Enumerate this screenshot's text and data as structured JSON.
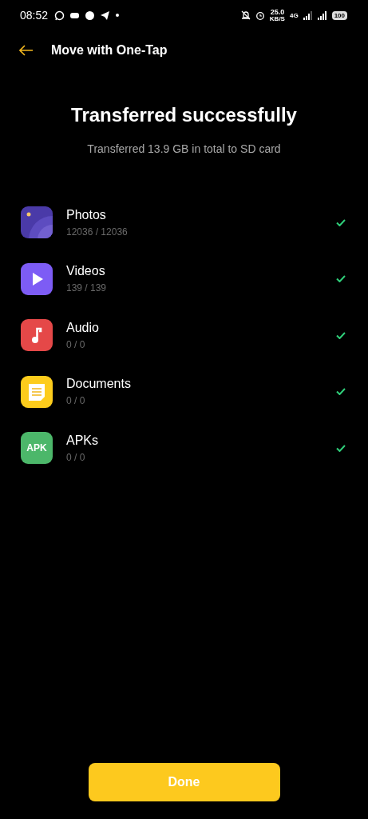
{
  "status_bar": {
    "time": "08:52",
    "speed": "25.0",
    "speed_unit": "KB/S",
    "network": "4G",
    "battery": "100"
  },
  "header": {
    "title": "Move with One-Tap"
  },
  "heading": "Transferred successfully",
  "summary": "Transferred 13.9 GB in total to SD card",
  "categories": [
    {
      "kind": "photos",
      "name": "Photos",
      "count": "12036 / 12036",
      "done": true
    },
    {
      "kind": "videos",
      "name": "Videos",
      "count": "139 / 139",
      "done": true
    },
    {
      "kind": "audio",
      "name": "Audio",
      "count": "0 / 0",
      "done": true
    },
    {
      "kind": "documents",
      "name": "Documents",
      "count": "0 / 0",
      "done": true
    },
    {
      "kind": "apk",
      "name": "APKs",
      "count": "0 / 0",
      "done": true,
      "icon_text": "APK"
    }
  ],
  "button": "Done"
}
